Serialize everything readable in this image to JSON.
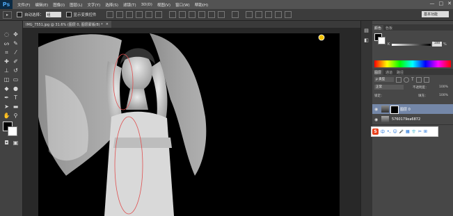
{
  "app": {
    "logo": "Ps"
  },
  "menu": {
    "items": [
      "文件(F)",
      "编辑(E)",
      "图像(I)",
      "图层(L)",
      "文字(Y)",
      "选择(S)",
      "滤镜(T)",
      "3D(D)",
      "视图(V)",
      "窗口(W)",
      "帮助(H)"
    ]
  },
  "window_controls": {
    "minimize": "—",
    "restore": "□",
    "close": "✕"
  },
  "options_bar": {
    "tool_icon": "▸",
    "auto_select_label": "自动选择：",
    "auto_select_value": "组",
    "show_transform_label": "显示变换控件",
    "workspace": "基本功能"
  },
  "document": {
    "tab_title": "IMG_7551.jpg @ 31.6% (图层 0, 图层蒙版/8) *",
    "tab_close": "×"
  },
  "color_panel": {
    "tabs": [
      "颜色",
      "色板"
    ],
    "k_label": "K",
    "k_value": "100",
    "percent": "%"
  },
  "layers_panel": {
    "tabs": [
      "图层",
      "通道",
      "路径"
    ],
    "kind_filter": "ρ 类型",
    "blend_mode": "正常",
    "opacity_label": "不透明度：",
    "opacity_value": "100%",
    "lock_label": "锁定：",
    "fill_label": "填充：",
    "fill_value": "100%",
    "layers": [
      {
        "name": "图层 0",
        "selected": true
      },
      {
        "name": "5760179ea6872",
        "selected": false
      }
    ]
  },
  "ime_toolbar": {
    "logo": "S",
    "mode": "中",
    "icons": [
      "•,",
      "☺",
      "🎤",
      "▦",
      "👕",
      "✂",
      "⊞"
    ]
  },
  "colors": {
    "foreground": "#000000",
    "background": "#ffffff",
    "selected_layer": "#7487a8"
  }
}
